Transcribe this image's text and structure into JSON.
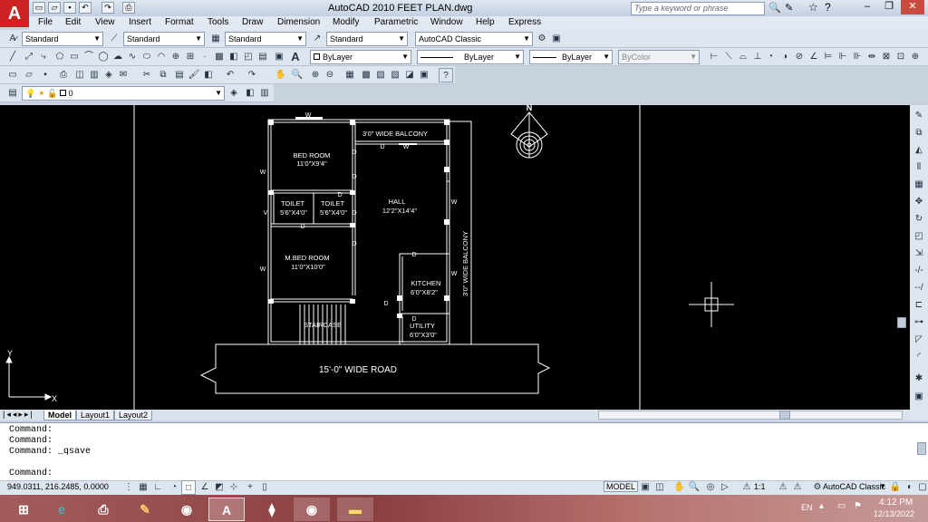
{
  "window": {
    "title": "AutoCAD 2010     FEET PLAN.dwg",
    "search_placeholder": "Type a keyword or phrase",
    "logo": "A",
    "min": "–",
    "restore": "❐",
    "close": "✕"
  },
  "menu": [
    "File",
    "Edit",
    "View",
    "Insert",
    "Format",
    "Tools",
    "Draw",
    "Dimension",
    "Modify",
    "Parametric",
    "Window",
    "Help",
    "Express"
  ],
  "styles_toolbar": {
    "text_style": "Standard",
    "dim_style": "Standard",
    "table_style": "Standard",
    "mleader_style": "Standard",
    "workspace": "AutoCAD Classic"
  },
  "layers_toolbar": {
    "color": "ByLayer",
    "linetype": "ByLayer",
    "lineweight": "ByLayer",
    "plotstyle": "ByColor",
    "layer": "0"
  },
  "drawing": {
    "north": "N",
    "rooms": {
      "bed_room": "BED ROOM",
      "bed_room_size": "11'0\"X9'4\"",
      "balcony_top": "3'0\" WIDE BALCONY",
      "toilet1": "TOILET",
      "toilet1_size": "5'6\"X4'0\"",
      "toilet2": "TOILET",
      "toilet2_size": "5'6\"X4'0\"",
      "hall": "HALL",
      "hall_size": "12'2\"X14'4\"",
      "mbed_room": "M.BED ROOM",
      "mbed_room_size": "11'0\"X10'0\"",
      "kitchen": "KITCHEN",
      "kitchen_size": "6'0\"X8'2\"",
      "utility": "UTILITY",
      "utility_size": "6'0\"X3'0\"",
      "staircase": "STAIRCASE",
      "balcony_side": "3'0\" WIDE BALCONY",
      "road": "15'-0\" WIDE ROAD"
    },
    "marks": {
      "window": "W",
      "door": "D",
      "ventilator": "V"
    },
    "ucs_x": "X",
    "ucs_y": "Y"
  },
  "layout_tabs": [
    "Model",
    "Layout1",
    "Layout2"
  ],
  "command_history": [
    "Command:",
    "Command:",
    "Command: _qsave"
  ],
  "command_prompt": "Command:",
  "status": {
    "coords": "949.0311, 216.2485, 0.0000",
    "model": "MODEL",
    "scale": "1:1",
    "workspace": "AutoCAD Classic"
  },
  "taskbar": {
    "lang": "EN",
    "time": "4:12 PM",
    "date": "12/13/2022"
  }
}
